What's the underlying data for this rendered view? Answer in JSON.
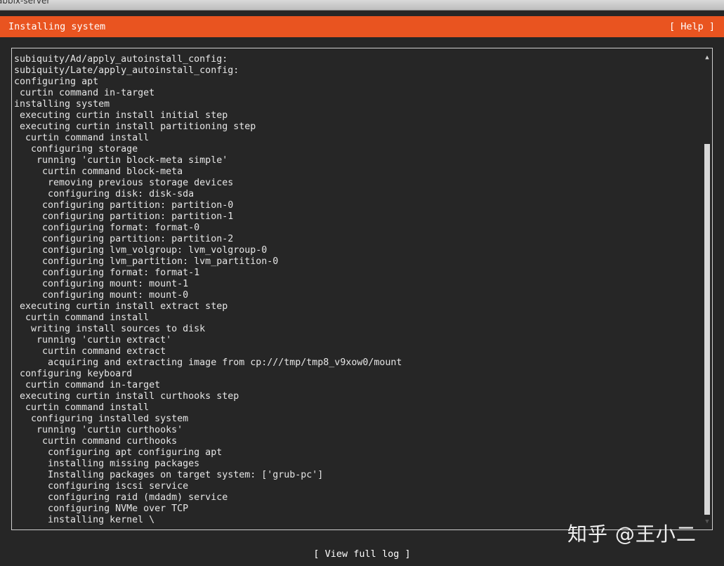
{
  "window": {
    "title": "abbix-server"
  },
  "header": {
    "title": "Installing system",
    "help_label": "[ Help ]",
    "accent_color": "#e95420"
  },
  "log": {
    "lines": [
      "subiquity/Ad/apply_autoinstall_config:",
      "subiquity/Late/apply_autoinstall_config:",
      "configuring apt",
      " curtin command in-target",
      "installing system",
      " executing curtin install initial step",
      " executing curtin install partitioning step",
      "  curtin command install",
      "   configuring storage",
      "    running 'curtin block-meta simple'",
      "     curtin command block-meta",
      "      removing previous storage devices",
      "      configuring disk: disk-sda",
      "     configuring partition: partition-0",
      "     configuring partition: partition-1",
      "     configuring format: format-0",
      "     configuring partition: partition-2",
      "     configuring lvm_volgroup: lvm_volgroup-0",
      "     configuring lvm_partition: lvm_partition-0",
      "     configuring format: format-1",
      "     configuring mount: mount-1",
      "     configuring mount: mount-0",
      " executing curtin install extract step",
      "  curtin command install",
      "   writing install sources to disk",
      "    running 'curtin extract'",
      "     curtin command extract",
      "      acquiring and extracting image from cp:///tmp/tmp8_v9xow0/mount",
      " configuring keyboard",
      "  curtin command in-target",
      " executing curtin install curthooks step",
      "  curtin command install",
      "   configuring installed system",
      "    running 'curtin curthooks'",
      "     curtin command curthooks",
      "      configuring apt configuring apt",
      "      installing missing packages",
      "      Installing packages on target system: ['grub-pc']",
      "      configuring iscsi service",
      "      configuring raid (mdadm) service",
      "      configuring NVMe over TCP",
      "      installing kernel \\"
    ]
  },
  "footer": {
    "view_log_label": "[ View full log ]"
  },
  "watermark": {
    "text": "知乎 @王小二"
  },
  "icons": {
    "scroll_up": "scroll-up-arrow-icon",
    "scroll_down": "scroll-down-arrow-icon"
  }
}
